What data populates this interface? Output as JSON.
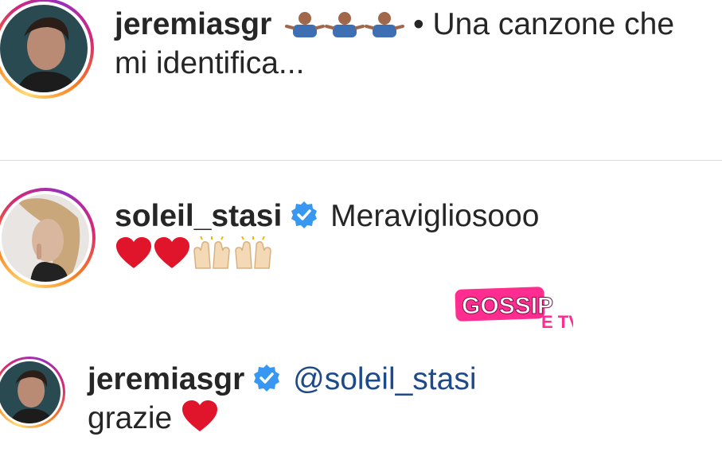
{
  "comments": [
    {
      "username": "jeremiasgr",
      "text_line1": "• Una canzone che",
      "text_line2": "mi identifica...",
      "emojis": [
        "person-shrugging-emoji",
        "person-shrugging-emoji",
        "person-shrugging-emoji"
      ]
    },
    {
      "username": "soleil_stasi",
      "verified": true,
      "text": "Meravigliosooo",
      "emojis": [
        "red-heart-emoji",
        "red-heart-emoji",
        "raising-hands-emoji",
        "raising-hands-emoji"
      ]
    },
    {
      "username": "jeremiasgr",
      "verified": true,
      "mention": "@soleil_stasi",
      "text": "grazie",
      "emojis": [
        "red-heart-emoji"
      ]
    }
  ],
  "watermark": {
    "text_main": "GOSSIP",
    "text_sub": "E TV"
  },
  "colors": {
    "username": "#262626",
    "mention": "#1f4a8a",
    "verified": "#3897f0",
    "heart": "#e0152b",
    "watermark": "#ff2d8f"
  }
}
